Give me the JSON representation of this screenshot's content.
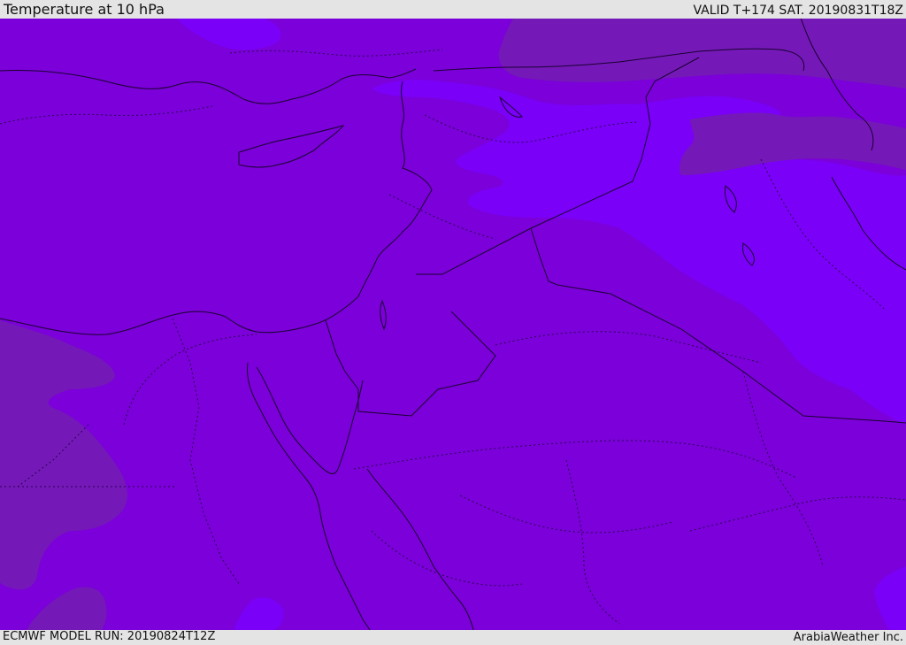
{
  "header": {
    "title": "Temperature at 10 hPa",
    "valid_time": "VALID T+174 SAT. 20190831T18Z"
  },
  "footer": {
    "model_run": "ECMWF MODEL RUN: 20190824T12Z",
    "credit": "ArabiaWeather Inc."
  },
  "map": {
    "colors": {
      "base_field": "#7b00d9",
      "cold_band": "#7a00f8",
      "warm_band": "#7419b7",
      "coastline": "#1a0030",
      "border_dotted": "#2a0050"
    }
  }
}
